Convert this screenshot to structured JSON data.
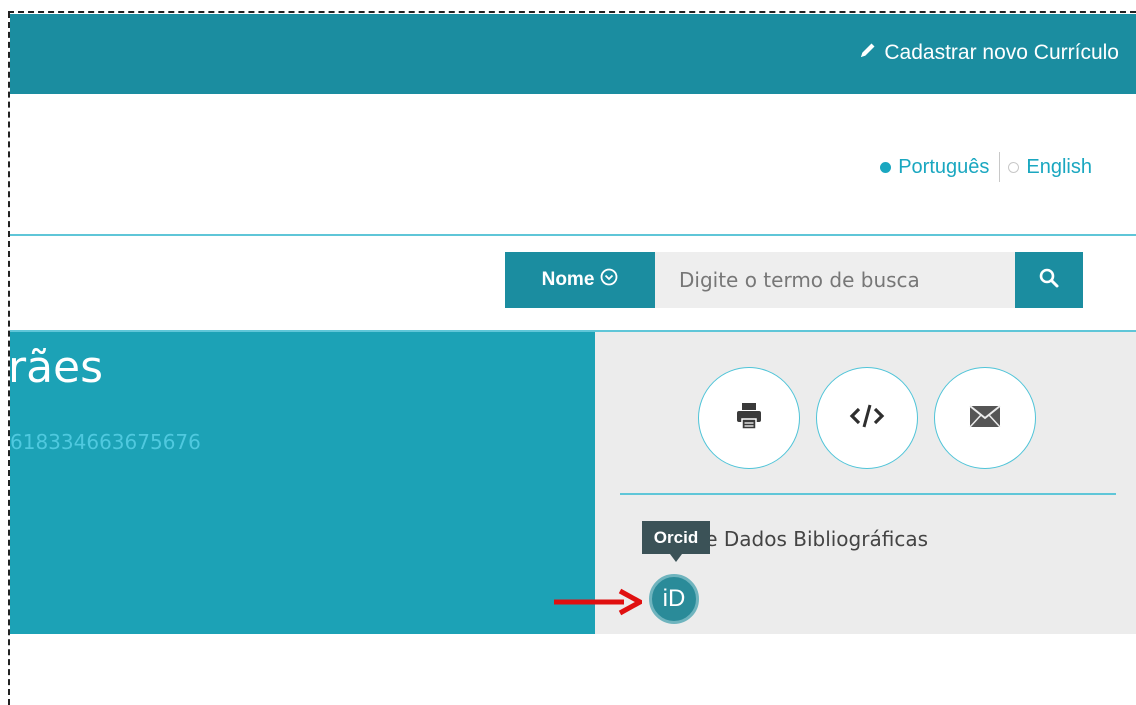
{
  "header": {
    "register_label": "Cadastrar novo Currículo",
    "bg_color": "#1b8da0"
  },
  "language": {
    "selected": "Português",
    "other": "English"
  },
  "search": {
    "field_label": "Nome",
    "placeholder": "Digite o termo de busca"
  },
  "profile": {
    "name_fragment": "rães",
    "id_fragment": "618334663675676",
    "bg_color": "#1ca2b6"
  },
  "tools": {
    "icons": [
      "printer-icon",
      "code-icon",
      "envelope-icon"
    ],
    "bibliographic_label": "ses de Dados Bibliográficas"
  },
  "orcid": {
    "tooltip": "Orcid",
    "badge_text": "iD"
  }
}
